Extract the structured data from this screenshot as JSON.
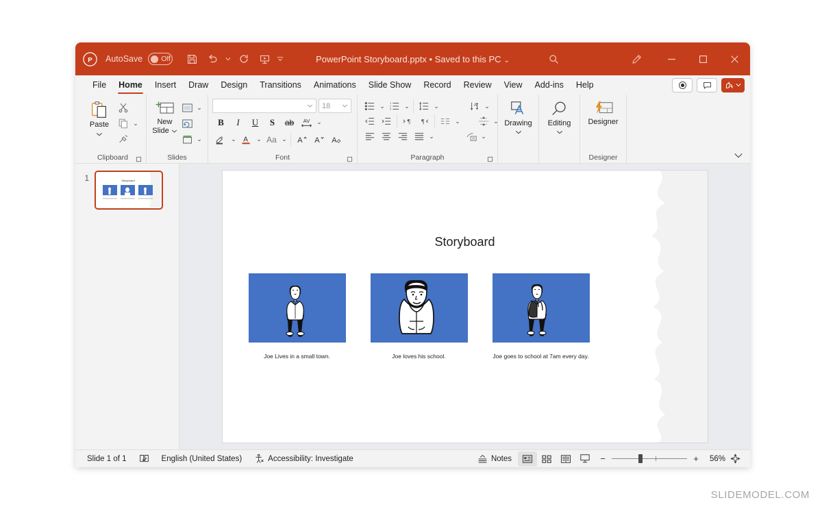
{
  "window": {
    "app": "PowerPoint",
    "titlebar": {
      "autosave_label": "AutoSave",
      "autosave_state": "Off",
      "document_title": "PowerPoint Storyboard.pptx • Saved to this PC",
      "quick_access": [
        {
          "name": "save-icon",
          "tooltip": "Save"
        },
        {
          "name": "undo-icon",
          "tooltip": "Undo"
        },
        {
          "name": "redo-icon",
          "tooltip": "Redo"
        },
        {
          "name": "start-presentation-icon",
          "tooltip": "Start From Beginning"
        },
        {
          "name": "customize-qat-icon",
          "tooltip": "Customize Quick Access Toolbar"
        }
      ],
      "search_icon": "search-icon",
      "window_controls": [
        {
          "name": "pen-icon",
          "label": "Ink"
        },
        {
          "name": "minimize-icon",
          "label": "Minimize"
        },
        {
          "name": "maximize-icon",
          "label": "Maximize"
        },
        {
          "name": "close-icon",
          "label": "Close"
        }
      ]
    },
    "tabs": [
      {
        "label": "File",
        "active": false
      },
      {
        "label": "Home",
        "active": true
      },
      {
        "label": "Insert",
        "active": false
      },
      {
        "label": "Draw",
        "active": false
      },
      {
        "label": "Design",
        "active": false
      },
      {
        "label": "Transitions",
        "active": false
      },
      {
        "label": "Animations",
        "active": false
      },
      {
        "label": "Slide Show",
        "active": false
      },
      {
        "label": "Record",
        "active": false
      },
      {
        "label": "Review",
        "active": false
      },
      {
        "label": "View",
        "active": false
      },
      {
        "label": "Add-ins",
        "active": false
      },
      {
        "label": "Help",
        "active": false
      }
    ],
    "tabs_right": [
      {
        "name": "record-button",
        "label": "Record"
      },
      {
        "name": "comments-button",
        "label": "Comments"
      },
      {
        "name": "share-button",
        "label": "Share"
      }
    ]
  },
  "ribbon": {
    "groups": [
      {
        "name": "clipboard",
        "label": "Clipboard",
        "paste_label": "Paste",
        "items": [
          "cut-icon",
          "copy-icon",
          "format-painter-icon"
        ],
        "has_launcher": true
      },
      {
        "name": "slides",
        "label": "Slides",
        "new_slide_label_1": "New",
        "new_slide_label_2": "Slide",
        "items": [
          "layout-icon",
          "reset-icon",
          "section-icon"
        ],
        "has_launcher": false
      },
      {
        "name": "font",
        "label": "Font",
        "font_name_value": "",
        "font_size_value": "18",
        "buttons": [
          "B",
          "I",
          "U",
          "S",
          "ab",
          "AV"
        ],
        "has_launcher": true
      },
      {
        "name": "paragraph",
        "label": "Paragraph",
        "has_launcher": true
      },
      {
        "name": "drawing",
        "label": "Drawing",
        "button_label": "Drawing"
      },
      {
        "name": "editing",
        "label": "Editing",
        "button_label": "Editing"
      },
      {
        "name": "designer",
        "label": "Designer",
        "button_label": "Designer"
      }
    ],
    "collapse_icon": "chevron-down-icon"
  },
  "thumbnails": [
    {
      "number": "1",
      "selected": true
    }
  ],
  "slide": {
    "title": "Storyboard",
    "cards": [
      {
        "caption": "Joe Lives in a small town.",
        "image": "person-standing-illustration"
      },
      {
        "caption": "Joe loves his school.",
        "image": "person-hoodie-portrait-illustration"
      },
      {
        "caption": "Joe goes to school at 7am every day.",
        "image": "person-backpack-illustration"
      }
    ],
    "image_bg_color": "#4472c4"
  },
  "statusbar": {
    "slide_count": "Slide 1 of 1",
    "spellcheck_icon": "spellcheck-icon",
    "language": "English (United States)",
    "accessibility_icon": "accessibility-icon",
    "accessibility": "Accessibility: Investigate",
    "notes_label": "Notes",
    "views": [
      {
        "name": "normal-view-button",
        "active": true
      },
      {
        "name": "slide-sorter-view-button",
        "active": false
      },
      {
        "name": "reading-view-button",
        "active": false
      },
      {
        "name": "slideshow-view-button",
        "active": false
      }
    ],
    "zoom_out": "−",
    "zoom_in": "+",
    "zoom_value": "56%",
    "fit_slide_icon": "fit-to-window-icon"
  },
  "watermark": "SLIDEMODEL.COM",
  "colors": {
    "accent": "#c43e1c",
    "ribbon_bg": "#f3f3f3",
    "canvas_bg": "#e9ebee",
    "image_blue": "#4472c4"
  }
}
